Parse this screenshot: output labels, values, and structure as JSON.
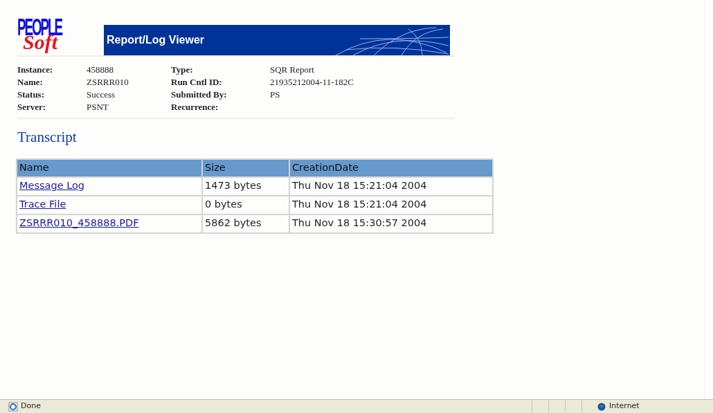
{
  "logo": {
    "top": "PEOPLE",
    "bottom": "Soft"
  },
  "banner": {
    "title": "Report/Log Viewer"
  },
  "details": [
    {
      "label": "Instance:",
      "value": "458888",
      "label2": "Type:",
      "value2": "SQR Report"
    },
    {
      "label": "Name:",
      "value": "ZSRRR010",
      "label2": "Run Cntl ID:",
      "value2": "21935212004-11-182C"
    },
    {
      "label": "Status:",
      "value": "Success",
      "label2": "Submitted By:",
      "value2": "PS"
    },
    {
      "label": "Server:",
      "value": "PSNT",
      "label2": "Recurrence:"
    }
  ],
  "section_title": "Transcript",
  "table": {
    "columns": [
      "Name",
      "Size",
      "CreationDate"
    ],
    "rows": [
      {
        "name": "Message Log",
        "size": "1473 bytes",
        "date": "Thu Nov 18 15:21:04 2004"
      },
      {
        "name": "Trace File",
        "size": "0 bytes",
        "date": "Thu Nov 18 15:21:04 2004"
      },
      {
        "name": "ZSRRR010_458888.PDF",
        "size": "5862 bytes",
        "date": "Thu Nov 18 15:30:57 2004"
      }
    ]
  },
  "status_bar": {
    "status": "Done",
    "zone": "Internet"
  }
}
